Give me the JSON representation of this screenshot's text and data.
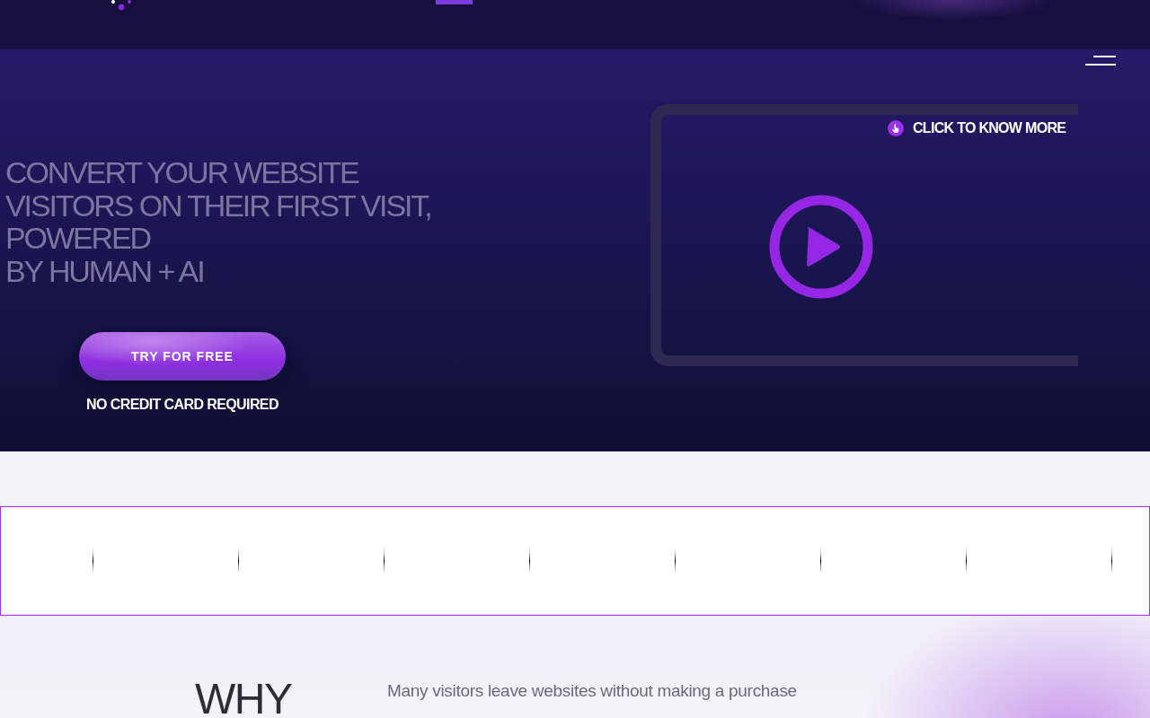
{
  "hero": {
    "headline": "CONVERT YOUR WEBSITE\nVISITORS ON THEIR FIRST VISIT,\nPOWERED\nBY HUMAN + AI",
    "cta_button": "TRY FOR FREE",
    "cta_note": "NO CREDIT CARD REQUIRED",
    "video": {
      "hint": "CLICK TO KNOW MORE"
    }
  },
  "why_section": {
    "title": "WHY",
    "text": "Many visitors leave websites without making a purchase"
  }
}
